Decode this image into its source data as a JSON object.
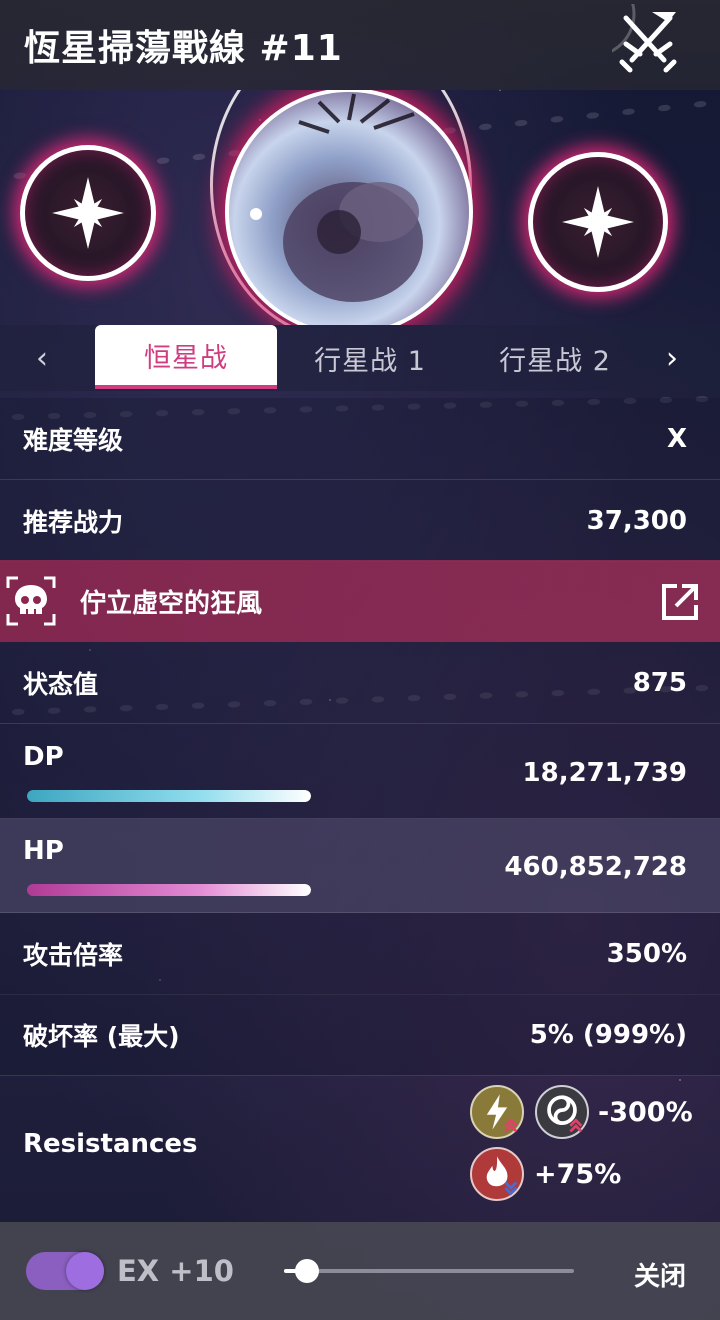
{
  "header": {
    "title": "恆星掃蕩戰線 #11",
    "emblem_icon": "crossed-swords-icon"
  },
  "stage": {
    "left_node_icon": "star-icon",
    "right_node_icon": "star-icon",
    "center_portrait": "boss-portrait"
  },
  "tabs": {
    "prev_icon": "chevron-left-icon",
    "next_icon": "chevron-right-icon",
    "items": [
      {
        "label": "恒星战",
        "active": true
      },
      {
        "label": "行星战 1",
        "active": false
      },
      {
        "label": "行星战 2",
        "active": false
      }
    ]
  },
  "info": {
    "difficulty_label": "难度等级",
    "difficulty_value": "X",
    "power_label": "推荐战力",
    "power_value": "37,300"
  },
  "boss": {
    "icon": "skull-icon",
    "name": "佇立虛空的狂風",
    "link_icon": "external-link-icon"
  },
  "stats": {
    "status_label": "状态值",
    "status_value": "875",
    "dp_label": "DP",
    "dp_value": "18,271,739",
    "dp_fill": 1.0,
    "hp_label": "HP",
    "hp_value": "460,852,728",
    "hp_fill": 1.0,
    "attack_label": "攻击倍率",
    "attack_value": "350%",
    "break_label": "破坏率 (最大)",
    "break_value": "5% (999%)"
  },
  "resistances": {
    "label": "Resistances",
    "group1_value": "-300%",
    "group1_icons": [
      "lightning-icon",
      "dark-icon"
    ],
    "group2_value": "+75%",
    "group2_icons": [
      "fire-icon"
    ]
  },
  "footer": {
    "ex_label": "EX +10",
    "ex_toggle_on": true,
    "slider_level": 0.08,
    "close_label": "关闭"
  },
  "colors": {
    "accent_pink": "#cf3c80",
    "boss_row": "#8c2850",
    "toggle_purple": "#8a5fbf"
  }
}
